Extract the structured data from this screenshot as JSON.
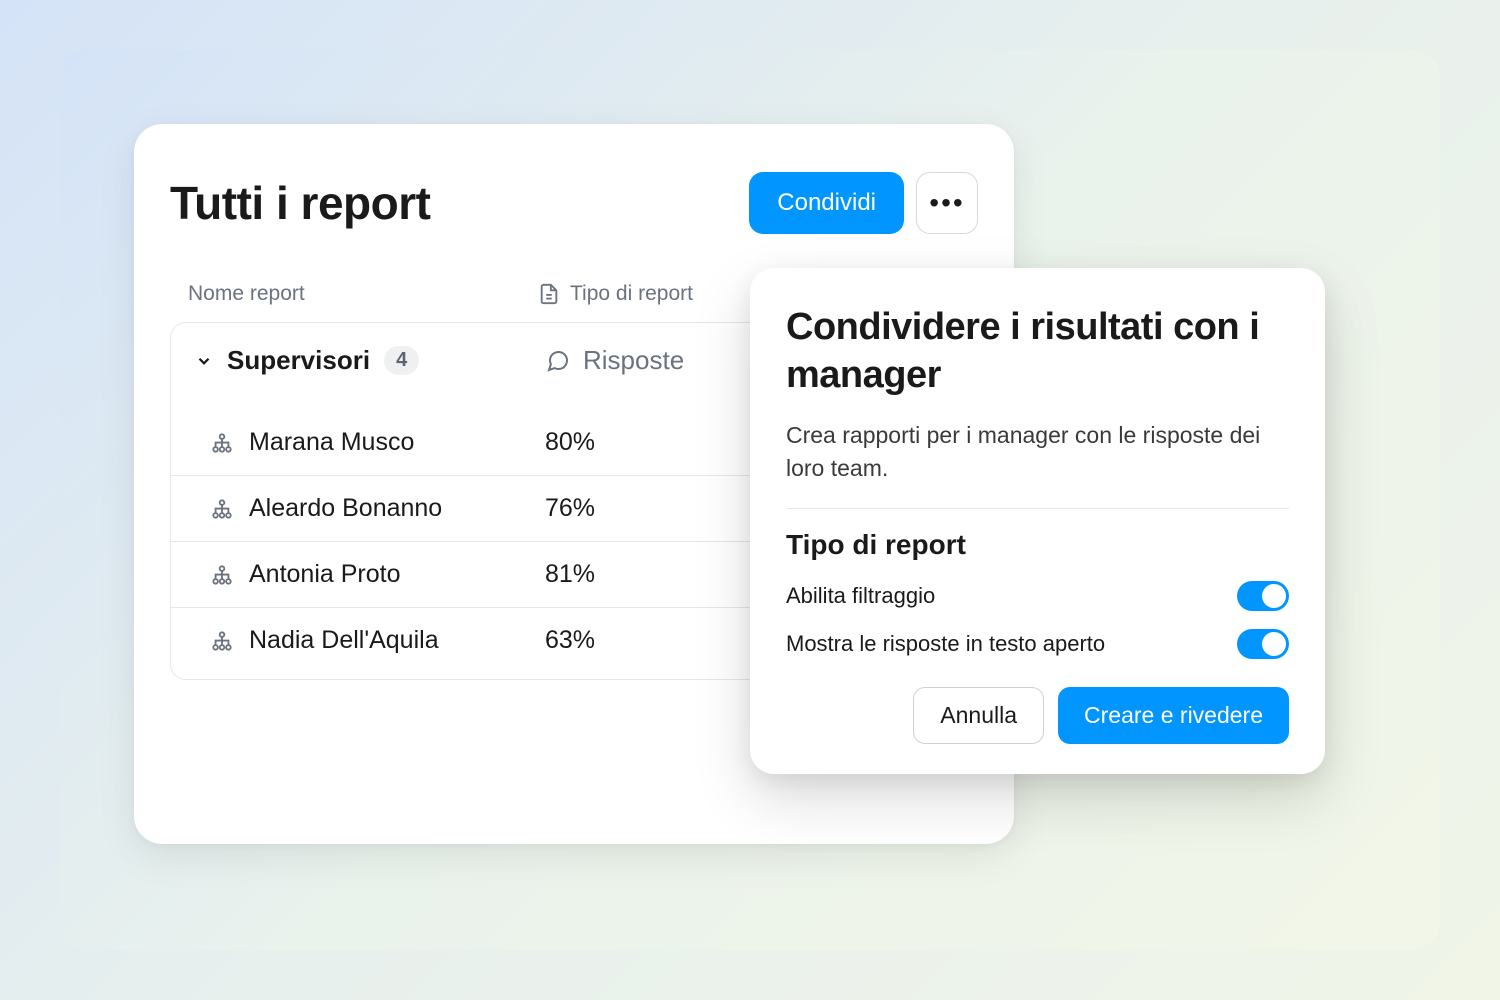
{
  "reports": {
    "title": "Tutti i report",
    "share_button": "Condividi",
    "columns": {
      "name": "Nome report",
      "type": "Tipo di report"
    },
    "group": {
      "name": "Supervisori",
      "count": "4",
      "type_label": "Risposte"
    },
    "rows": [
      {
        "name": "Marana Musco",
        "percent": "80%"
      },
      {
        "name": "Aleardo Bonanno",
        "percent": "76%"
      },
      {
        "name": "Antonia Proto",
        "percent": "81%"
      },
      {
        "name": "Nadia Dell'Aquila",
        "percent": "63%"
      }
    ]
  },
  "modal": {
    "title": "Condividere i risultati con i manager",
    "description": "Crea rapporti per i manager con le risposte dei loro team.",
    "section_title": "Tipo di report",
    "toggles": {
      "filter": "Abilita filtraggio",
      "open_text": "Mostra le risposte in testo aperto"
    },
    "actions": {
      "cancel": "Annulla",
      "create": "Creare e rivedere"
    }
  }
}
